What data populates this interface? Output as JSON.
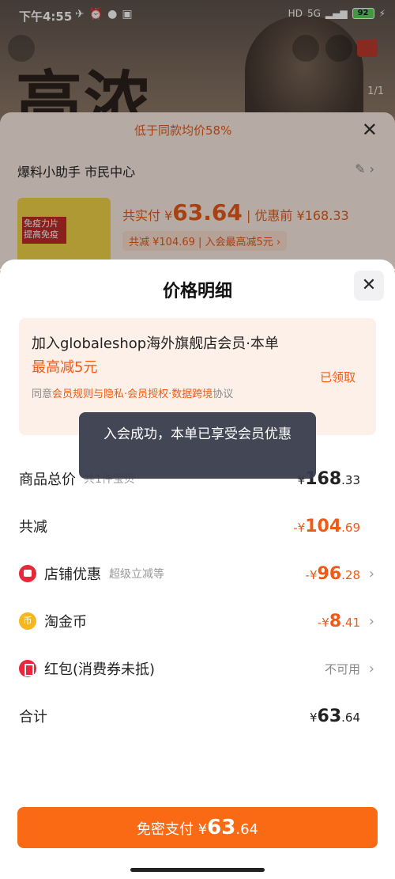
{
  "status_bar": {
    "time": "下午4:55",
    "battery": "92",
    "network": "5G"
  },
  "background": {
    "hero_text": "高浓",
    "image_counter": "1/1",
    "ribbon": "低于同款均价58%",
    "helper": "爆料小助手 市民中心",
    "product_thumb_text": "免疫力片 提高免疫",
    "price_label": "共实付 ¥",
    "price_main": "63.64",
    "price_before": "| 优惠前 ¥168.33",
    "sub_line": "共减 ¥104.69 | 入会最高减5元 ›"
  },
  "sheet": {
    "title": "价格明细",
    "close": "✕",
    "member": {
      "title_prefix": "加入globaleshop海外旗舰店会员·本单",
      "title_highlight": "最高减5元",
      "claimed": "已领取",
      "agree_prefix": "同意",
      "agree_link": "会员规则与隐私·会员授权·数据跨境",
      "agree_suffix": "协议"
    },
    "toast": "入会成功，本单已享受会员优惠",
    "rows": {
      "goods_total": {
        "label": "商品总价",
        "hint": "共1件宝贝",
        "currency": "¥",
        "int": "168",
        "dec": ".33"
      },
      "total_discount": {
        "label": "共减",
        "currency": "-¥",
        "int": "104",
        "dec": ".69"
      },
      "shop_discount": {
        "label": "店铺优惠",
        "hint": "超级立减等",
        "currency": "-¥",
        "int": "96",
        "dec": ".28"
      },
      "taojinbi": {
        "label": "淘金币",
        "currency": "-¥",
        "int": "8",
        "dec": ".41"
      },
      "redpacket": {
        "label": "红包(消费券未抵)",
        "value": "不可用"
      },
      "sum": {
        "label": "合计",
        "currency": "¥",
        "int": "63",
        "dec": ".64"
      }
    },
    "pay_button": {
      "label": "免密支付 ¥",
      "int": "63",
      "dec": ".64"
    }
  }
}
